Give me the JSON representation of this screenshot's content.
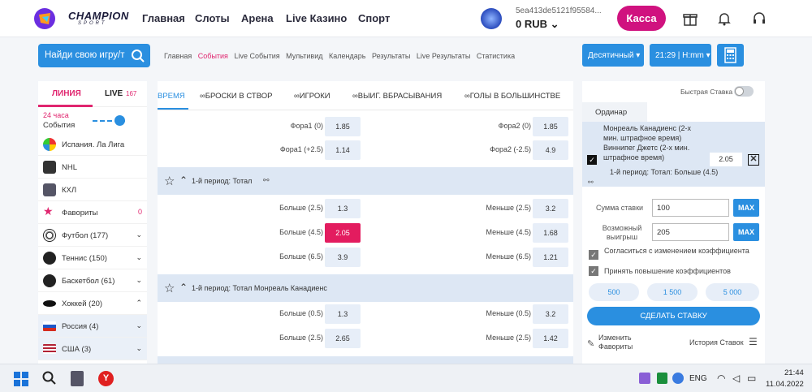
{
  "header": {
    "brand": "CHAMPION",
    "brand_sub": "SPORT",
    "nav": [
      "Главная",
      "Слоты",
      "Арена",
      "Live Казино",
      "Спорт"
    ],
    "user_id": "5ea413de5121f95584...",
    "balance": "0 RUB",
    "cashier": "Касса"
  },
  "subheader": {
    "search_placeholder": "Найди свою игру/т",
    "links": [
      "Главная",
      "События",
      "Live События",
      "Мультивид",
      "Календарь",
      "Результаты",
      "Live Результаты",
      "Статистика"
    ],
    "active_link": "События",
    "odds_format": "Десятичный",
    "time_format": "21:29 | H:mm"
  },
  "left": {
    "tab_line": "ЛИНИЯ",
    "tab_live": "LIVE",
    "live_count": "167",
    "period": "24 часа",
    "events_label": "События",
    "items": [
      {
        "label": "Испания. Ла Лига",
        "count": ""
      },
      {
        "label": "NHL",
        "count": ""
      },
      {
        "label": "КХЛ",
        "count": ""
      },
      {
        "label": "Фавориты",
        "count": "0"
      },
      {
        "label": "Футбол (177)",
        "count": ""
      },
      {
        "label": "Теннис (150)",
        "count": ""
      },
      {
        "label": "Баскетбол (61)",
        "count": ""
      },
      {
        "label": "Хоккей (20)",
        "count": ""
      },
      {
        "label": "Россия (4)",
        "count": ""
      },
      {
        "label": "США (3)",
        "count": ""
      }
    ]
  },
  "center": {
    "tabs": [
      "ВРЕМЯ",
      "БРОСКИ В СТВОР",
      "ИГРОКИ",
      "ВЫИГ. ВБРАСЫВАНИЯ",
      "ГОЛЫ В БОЛЬШИНСТВЕ"
    ],
    "handicap_rows": [
      {
        "l": "Фора1 (0)",
        "lv": "1.85",
        "r": "Фора2 (0)",
        "rv": "1.85"
      },
      {
        "l": "Фора1 (+2.5)",
        "lv": "1.14",
        "r": "Фора2 (-2.5)",
        "rv": "4.9"
      }
    ],
    "group1_title": "1-й период: Тотал",
    "group1_rows": [
      {
        "l": "Больше (2.5)",
        "lv": "1.3",
        "r": "Меньше (2.5)",
        "rv": "3.2"
      },
      {
        "l": "Больше (4.5)",
        "lv": "2.05",
        "r": "Меньше (4.5)",
        "rv": "1.68"
      },
      {
        "l": "Больше (6.5)",
        "lv": "3.9",
        "r": "Меньше (6.5)",
        "rv": "1.21"
      }
    ],
    "group2_title": "1-й период: Тотал Монреаль Канадиенс",
    "group2_rows": [
      {
        "l": "Больше (0.5)",
        "lv": "1.3",
        "r": "Меньше (0.5)",
        "rv": "3.2"
      },
      {
        "l": "Больше (2.5)",
        "lv": "2.65",
        "r": "Меньше (2.5)",
        "rv": "1.42"
      }
    ]
  },
  "betslip": {
    "quick_bet": "Быстрая Ставка",
    "ordinar": "Ординар",
    "event": "Монреаль Канадиенс (2-х мин. штрафное время) Виннипег Джетс (2-х мин. штрафное время)",
    "market": "1-й период: Тотал: Больше (4.5)",
    "odd": "2.05",
    "stake_label": "Сумма ставки",
    "stake_value": "100",
    "win_label": "Возможный выигрыш",
    "win_value": "205",
    "max": "MAX",
    "agree_change": "Согласиться с изменением коэффициента",
    "accept_raise": "Принять повышение коэффициентов",
    "quick_amounts": [
      "500",
      "1 500",
      "5 000"
    ],
    "place_bet": "СДЕЛАТЬ СТАВКУ",
    "edit_fav": "Изменить Фавориты",
    "history": "История Ставок"
  },
  "taskbar": {
    "lang": "ENG",
    "time": "21:44",
    "date": "11.04.2022"
  }
}
